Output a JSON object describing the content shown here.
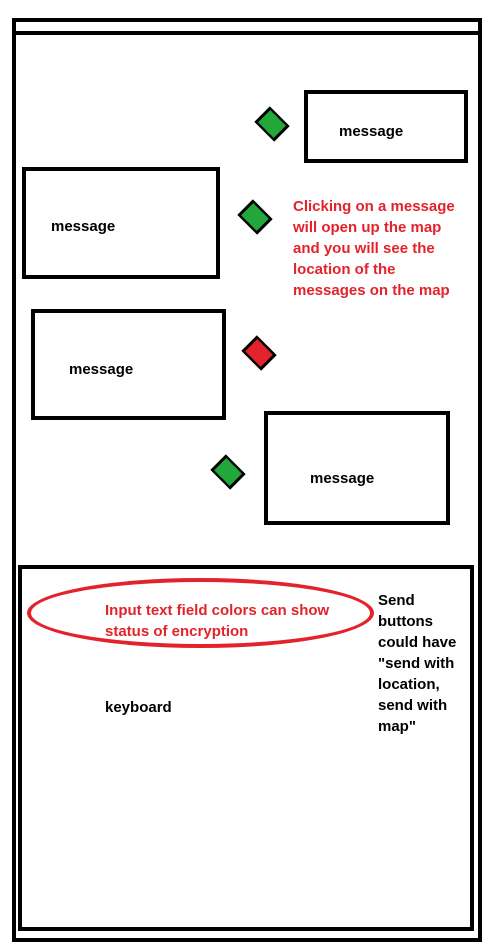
{
  "messages": [
    {
      "label": "message",
      "status_color": "#22a83a"
    },
    {
      "label": "message",
      "status_color": "#22a83a"
    },
    {
      "label": "message",
      "status_color": "#e3232b"
    },
    {
      "label": "message",
      "status_color": "#22a83a"
    }
  ],
  "annotations": {
    "map_note": [
      "Clicking on a message",
      "will open up the map",
      "and you will see the",
      "location of the",
      "messages on the map"
    ],
    "input_note": [
      "Input text field colors can show",
      "status of encryption"
    ],
    "send_note": [
      "Send",
      "buttons",
      "could have",
      "\"send with",
      "location,",
      "send with",
      "map\""
    ]
  },
  "keyboard": {
    "label": "keyboard"
  },
  "colors": {
    "accent_red": "#e3232b",
    "status_green": "#22a83a",
    "outline": "#000000"
  }
}
